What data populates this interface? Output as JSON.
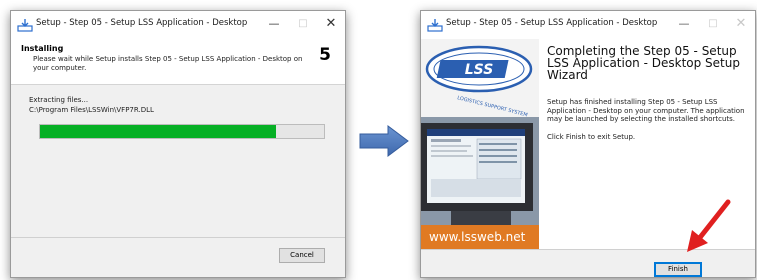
{
  "colors": {
    "progress_fill": "#06b025",
    "arrow_blue": "#4a76b8",
    "annotation_red": "#e02020",
    "brand_orange": "#e07a23",
    "logo_blue": "#2b5fb1"
  },
  "installing_window": {
    "title": "Setup - Step 05 - Setup LSS Application - Desktop",
    "header_title": "Installing",
    "header_description": "Please wait while Setup installs Step 05 - Setup LSS Application - Desktop on your computer.",
    "step_number": "5",
    "status_text": "Extracting files...",
    "file_path": "C:\\Program Files\\LSSWin\\VFP7R.DLL",
    "progress_fraction": 0.83,
    "cancel_label": "Cancel",
    "icons": [
      "setup-icon",
      "minimize-icon",
      "maximize-icon",
      "close-icon"
    ]
  },
  "complete_window": {
    "title": "Setup - Step 05 - Setup LSS Application - Desktop",
    "heading": "Completing the Step 05 - Setup LSS Application - Desktop Setup Wizard",
    "body_text": "Setup has finished installing Step 05 - Setup LSS Application - Desktop on your computer. The application may be launched by selecting the installed shortcuts.",
    "exit_text": "Click Finish to exit Setup.",
    "logo_text": "LSS",
    "logo_arc_text": "LOGISTICS SUPPORT SYSTEM",
    "website": "www.lssweb.net",
    "finish_label": "Finish",
    "icons": [
      "setup-icon",
      "minimize-icon",
      "maximize-icon",
      "close-icon"
    ]
  },
  "annotations": {
    "transition_arrow": "right-arrow-icon",
    "pointer_arrow": "red-pointer-arrow-icon"
  }
}
